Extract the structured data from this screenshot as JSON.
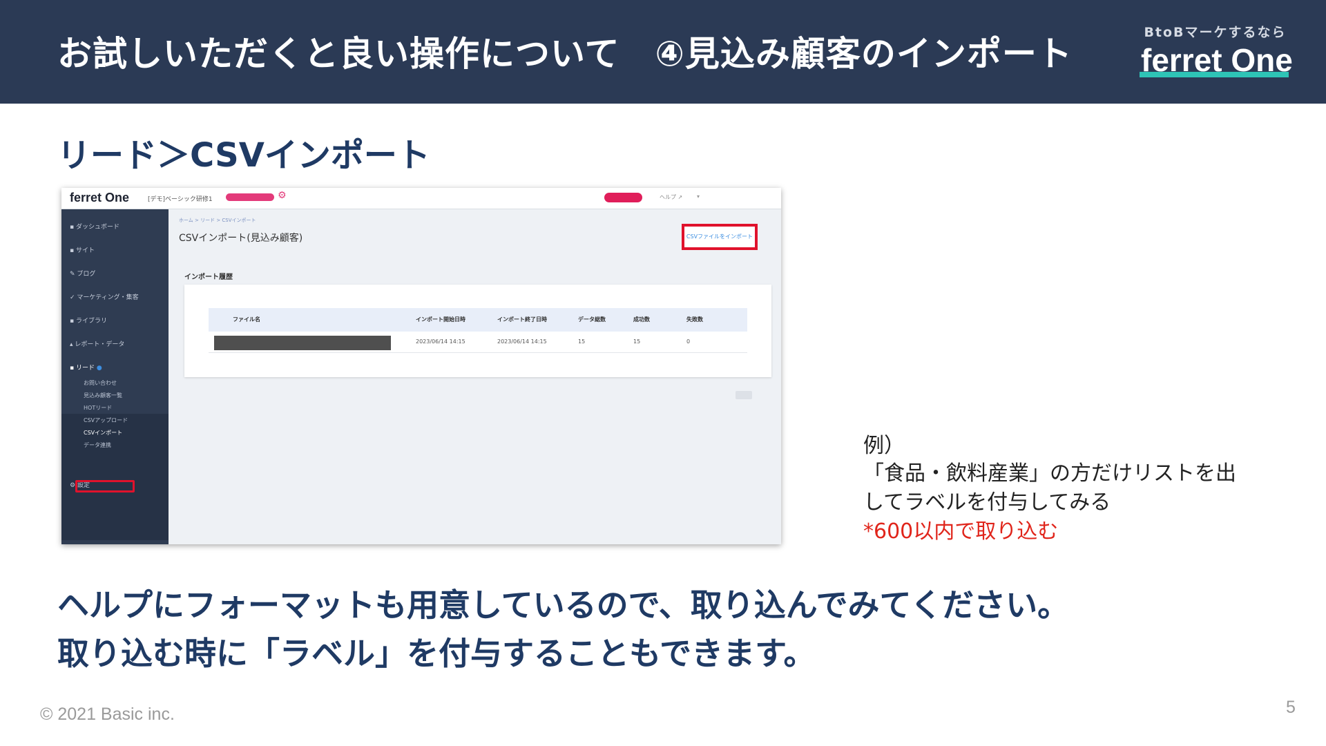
{
  "header": {
    "title": "お試しいただくと良い操作について　④見込み顧客のインポート",
    "logo_tagline": "BtoBマーケするなら",
    "logo_name": "ferret One",
    "colors": {
      "background": "#2b3a55",
      "logo_bar": "#2ec4b6"
    }
  },
  "section_title": "リード＞CSVインポート",
  "app": {
    "logo": "ferret One",
    "site_name": "[デモ]ベーシック研修1",
    "plan_badge_color": "#e33a7a",
    "sidebar": [
      "ダッシュボード",
      "サイト",
      "ブログ",
      "マーケティング・集客",
      "ライブラリ",
      "レポート・データ",
      "リード",
      "設定"
    ],
    "lead_submenu": [
      "お問い合わせ",
      "見込み顧客一覧",
      "HOTリード",
      "CSVアップロード",
      "CSVインポート",
      "データ連携"
    ],
    "breadcrumb": "ホーム > リード > CSVインポート",
    "page_title": "CSVインポート(見込み顧客)",
    "import_button": "CSVファイルをインポート",
    "history_label": "インポート履歴",
    "table": {
      "headers": [
        "ファイル名",
        "インポート開始日時",
        "インポート終了日時",
        "データ総数",
        "成功数",
        "失敗数"
      ],
      "rows": [
        [
          "",
          "2023/06/14 14:15",
          "2023/06/14 14:15",
          "15",
          "15",
          "0"
        ]
      ]
    },
    "highlight_color": "#e0122c"
  },
  "example": {
    "label": "例）",
    "line1": "「食品・飲料産業」の方だけリストを出",
    "line2": "してラベルを付与してみる",
    "note": "*600以内で取り込む",
    "note_color": "#e0251b"
  },
  "message": {
    "line1": "ヘルプにフォーマットも用意しているので、取り込んでみてください。",
    "line2": "取り込む時に「ラベル」を付与することもできます。"
  },
  "footer": {
    "copyright": "© 2021 Basic inc.",
    "page_number": "5"
  }
}
